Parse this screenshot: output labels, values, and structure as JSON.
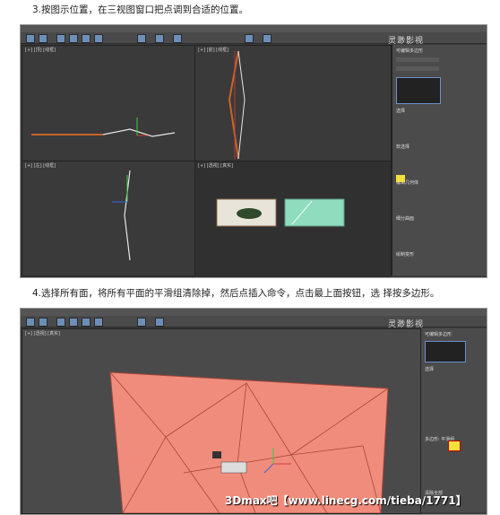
{
  "step3": {
    "text": "3.按图示位置，在三视图窗口把点调到合适的位置。"
  },
  "step4": {
    "text": "4.选择所有面，将所有平面的平滑组清除掉，然后点插入命令，点击最上面按钮，选 择按多边形。"
  },
  "screenshot1": {
    "watermark": "灵渺影视",
    "viewports": [
      {
        "label": "[+] [顶] [线框]"
      },
      {
        "label": "[+] [前] [线框]"
      },
      {
        "label": "[+] [左] [线框]"
      },
      {
        "label": "[+] [透视] [真实]"
      }
    ],
    "panel_items": [
      "可编辑多边形",
      "选择",
      "软选择",
      "编辑几何体",
      "细分曲面",
      "绘制变形"
    ]
  },
  "screenshot2": {
    "watermark": "灵渺影视",
    "viewport_label": "[+] [透视] [真实]",
    "caption": "3Dmax吧【www.linecg.com/tieba/1771】",
    "panel_items": [
      "可编辑多边形",
      "选择",
      "多边形: 平滑组",
      "清除全部"
    ]
  },
  "colors": {
    "surface": "#f08c7c",
    "edge": "#a8473b",
    "ui_dark": "#3c3c3c"
  }
}
